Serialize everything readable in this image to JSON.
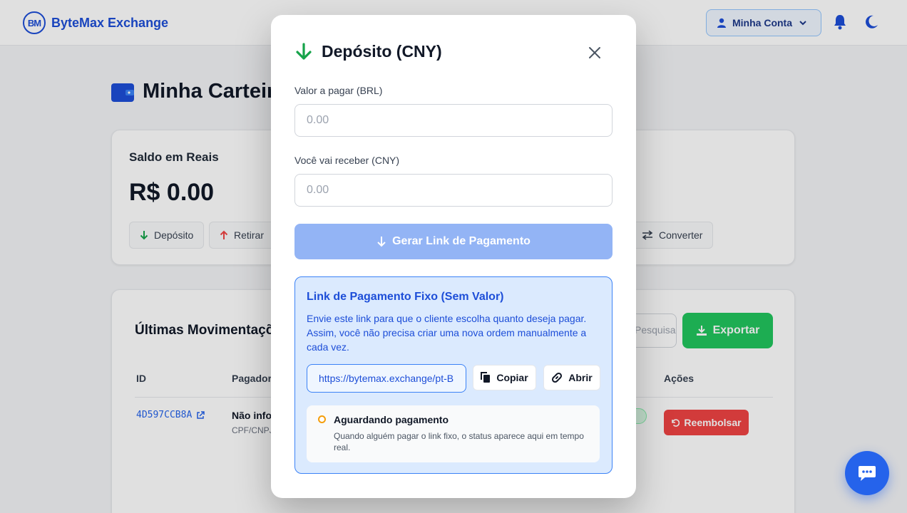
{
  "header": {
    "logo_mark": "BM",
    "brand": "ByteMax Exchange",
    "account_label": "Minha Conta"
  },
  "page": {
    "title": "Minha Carteira"
  },
  "balance": {
    "label": "Saldo em Reais",
    "value": "R$ 0.00",
    "actions": {
      "deposit": "Depósito",
      "withdraw": "Retirar",
      "convert": "Converter"
    }
  },
  "transactions": {
    "title": "Últimas Movimentações",
    "search_placeholder": "Pesquisar moeda ou",
    "export_label": "Exportar",
    "columns": {
      "id": "ID",
      "payer": "Pagador",
      "actions": "Ações"
    },
    "rows": [
      {
        "id": "4D597CCB8A",
        "payer": "Não informado",
        "doc": "CPF/CNPJ",
        "action": "Reembolsar"
      }
    ]
  },
  "modal": {
    "title": "Depósito (CNY)",
    "pay_label": "Valor a pagar (BRL)",
    "pay_placeholder": "0.00",
    "receive_label": "Você vai receber (CNY)",
    "receive_placeholder": "0.00",
    "generate_label": "Gerar Link de Pagamento",
    "fixed": {
      "title": "Link de Pagamento Fixo (Sem Valor)",
      "description": "Envie este link para que o cliente escolha quanto deseja pagar. Assim, você não precisa criar uma nova ordem manualmente a cada vez.",
      "link": "https://bytemax.exchange/pt-BR/pay",
      "copy_label": "Copiar",
      "open_label": "Abrir",
      "status_title": "Aguardando pagamento",
      "status_desc": "Quando alguém pagar o link fixo, o status aparece aqui em tempo real."
    }
  },
  "colors": {
    "primary": "#1d4ed8",
    "success": "#22c55e",
    "danger": "#ef4444",
    "pending": "#f59e0b"
  }
}
